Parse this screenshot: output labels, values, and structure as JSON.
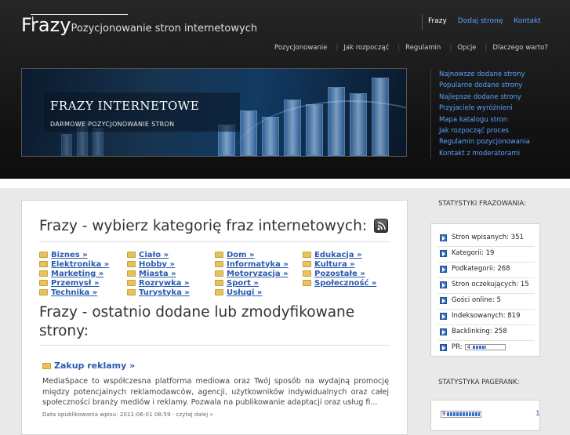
{
  "header": {
    "logo": "Frazy",
    "separator": "|",
    "tagline": "Pozycjonowanie stron internetowych",
    "top_links": [
      "Frazy",
      "Dodaj stronę",
      "Kontakt"
    ],
    "nav": [
      "Pozycjonowanie",
      "Jak rozpocząć",
      "Regulamin",
      "Opcje",
      "Dlaczego warto?"
    ],
    "banner_title": "FRAZY INTERNETOWE",
    "banner_subtitle": "DARMOWE POZYCJONOWANIE STRON",
    "right_links": [
      "Najnowsze dodane strony",
      "Popularne dodane strony",
      "Najlepsze dodane strony",
      "Przyjaciele wyróżnieni",
      "Mapa katalogu stron",
      "Jak rozpocząć proces",
      "Regulamin pozycjonowania",
      "Kontakt z moderatorami"
    ]
  },
  "main": {
    "heading": "Frazy - wybierz kategorię fraz internetowych:",
    "categories": [
      "Biznes »",
      "Ciało »",
      "Dom »",
      "Edukacja »",
      "Elektronika »",
      "Hobby »",
      "Informatyka »",
      "Kultura »",
      "Marketing »",
      "Miasta »",
      "Motoryzacja »",
      "Pozostałe »",
      "Przemysł »",
      "Rozrywka »",
      "Sport »",
      "Społeczność »",
      "Technika »",
      "Turystyka »",
      "Usługi »"
    ],
    "recent_heading": "Frazy - ostatnio dodane lub zmodyfikowane strony:",
    "article": {
      "title": "Zakup reklamy »",
      "body": "MediaSpace to współczesna platforma mediowa oraz Twój sposób na wydajną promocję między potencjalnych reklamodawców, agencji, użytkowników indywidualnych oraz całej społeczności branży mediów i reklamy. Pozwala na publikowanie adaptacji oraz usług fi...",
      "meta": "Data opublikowania wpisu: 2011-06-01 08:59 · czytaj dalej »"
    }
  },
  "sidebar": {
    "stats_heading": "STATYSTYKI FRAZOWANIA:",
    "stats": [
      "Stron wpisanych: 351",
      "Kategorii: 19",
      "Podkategorii: 268",
      "Stron oczekujących: 15",
      "Gości online: 5",
      "Indeksowanych: 819",
      "Backlinking: 258"
    ],
    "pr_label": "PR:",
    "pr_value": "4",
    "pr_fraction": 0.4,
    "pagerank_heading": "STATYSTYKA PAGERANK:",
    "pagerank_row_value": "9",
    "pagerank_row_count": "1"
  },
  "colors": {
    "link": "#5aa0ff",
    "accent": "#2a5cb0"
  }
}
